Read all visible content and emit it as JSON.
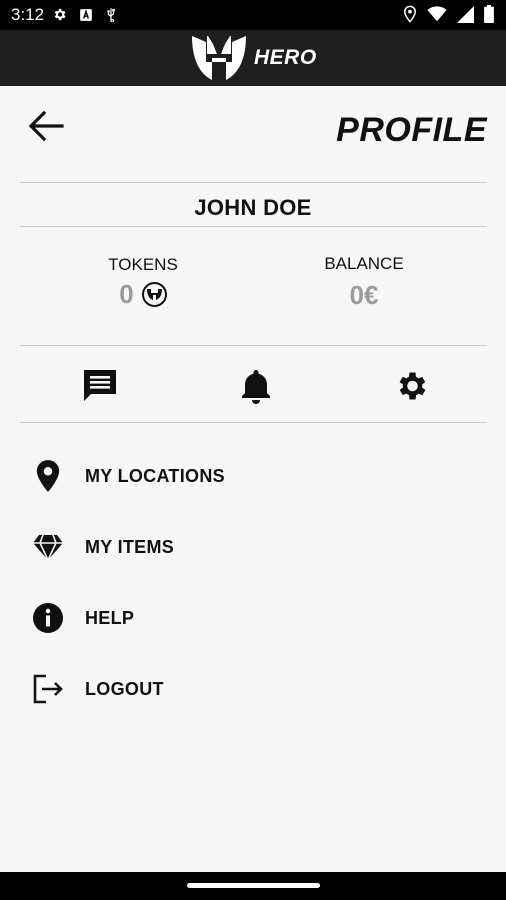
{
  "status_bar": {
    "time": "3:12",
    "left_icons": [
      "gear-icon",
      "a-notification-icon",
      "usb-icon"
    ],
    "right_icons": [
      "location-icon",
      "wifi-icon",
      "signal-icon",
      "battery-icon"
    ]
  },
  "app_bar": {
    "logo_text": "HERO"
  },
  "header": {
    "title": "PROFILE",
    "back_icon": "arrow-left-icon"
  },
  "user": {
    "name": "JOHN DOE"
  },
  "stats": {
    "tokens_label": "TOKENS",
    "tokens_value": "0",
    "balance_label": "BALANCE",
    "balance_value": "0€"
  },
  "actions": [
    "chat-icon",
    "bell-icon",
    "settings-icon"
  ],
  "menu": [
    {
      "label": "MY LOCATIONS",
      "icon": "location-pin-icon"
    },
    {
      "label": "MY ITEMS",
      "icon": "diamond-icon"
    },
    {
      "label": "HELP",
      "icon": "info-icon"
    },
    {
      "label": "LOGOUT",
      "icon": "logout-icon"
    }
  ],
  "colors": {
    "app_bar": "#1e1e1e",
    "background": "#f7f7f7",
    "muted_value": "#9b9b9b"
  }
}
